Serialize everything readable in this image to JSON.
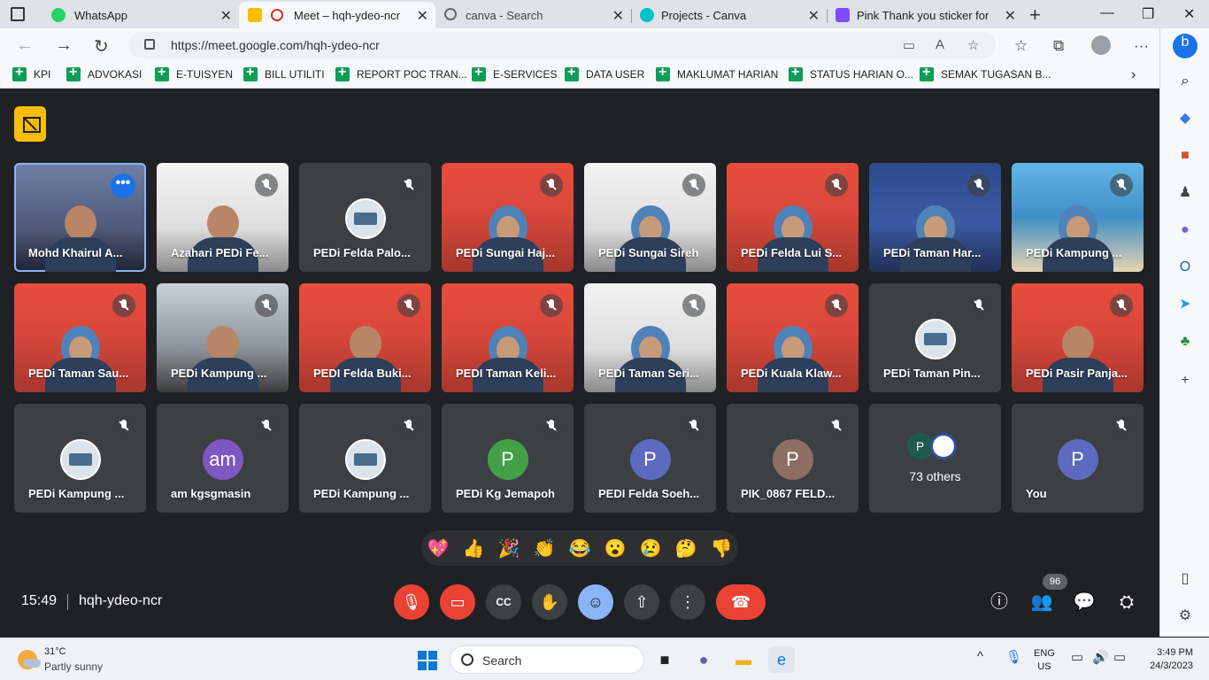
{
  "browser": {
    "tabs": [
      {
        "title": "WhatsApp",
        "active": false
      },
      {
        "title": "Meet – hqh-ydeo-ncr",
        "active": true
      },
      {
        "title": "canva - Search",
        "active": false
      },
      {
        "title": "Projects - Canva",
        "active": false
      },
      {
        "title": "Pink Thank you sticker for sm",
        "active": false
      }
    ],
    "url": "https://meet.google.com/hqh-ydeo-ncr",
    "bookmarks": [
      "KPI",
      "ADVOKASI",
      "E-TUISYEN",
      "BILL UTILITI",
      "REPORT POC TRAN...",
      "E-SERVICES",
      "DATA USER",
      "MAKLUMAT HARIAN",
      "STATUS HARIAN O...",
      "SEMAK TUGASAN B..."
    ]
  },
  "meet": {
    "participants": [
      {
        "name": "Mohd Khairul A...",
        "type": "video",
        "bg": "dusk",
        "menu": true
      },
      {
        "name": "Azahari PEDi Fe...",
        "type": "video",
        "bg": "white"
      },
      {
        "name": "PEDi Felda Palo...",
        "type": "avatar-img"
      },
      {
        "name": "PEDi Sungai Haj...",
        "type": "video",
        "bg": "red",
        "hijab": true
      },
      {
        "name": "PEDi Sungai Sireh",
        "type": "video",
        "bg": "white",
        "hijab": true
      },
      {
        "name": "PEDi Felda Lui S...",
        "type": "video",
        "bg": "red",
        "hijab": true
      },
      {
        "name": "PEDi Taman Har...",
        "type": "video",
        "bg": "blue",
        "hijab": true
      },
      {
        "name": "PEDi Kampung ...",
        "type": "video",
        "bg": "beach",
        "hijab": true
      },
      {
        "name": "PEDi Taman Sau...",
        "type": "video",
        "bg": "red",
        "hijab": true
      },
      {
        "name": "PEDi Kampung ...",
        "type": "video",
        "bg": "room"
      },
      {
        "name": "PEDI Felda Buki...",
        "type": "video",
        "bg": "red"
      },
      {
        "name": "PEDI Taman Keli...",
        "type": "video",
        "bg": "red",
        "hijab": true
      },
      {
        "name": "PEDi Taman Seri...",
        "type": "video",
        "bg": "white",
        "hijab": true
      },
      {
        "name": "PEDi Kuala Klaw...",
        "type": "video",
        "bg": "red",
        "hijab": true
      },
      {
        "name": "PEDi Taman Pin...",
        "type": "avatar-img"
      },
      {
        "name": "PEDi Pasir Panja...",
        "type": "video",
        "bg": "red"
      },
      {
        "name": "PEDi Kampung ...",
        "type": "avatar-img"
      },
      {
        "name": "am kgsgmasin",
        "type": "avatar",
        "letter": "am",
        "color": "#7e57c2"
      },
      {
        "name": "PEDi Kampung ...",
        "type": "avatar-img"
      },
      {
        "name": "PEDi Kg Jemapoh",
        "type": "avatar",
        "letter": "P",
        "color": "#43a047"
      },
      {
        "name": "PEDI Felda Soeh...",
        "type": "avatar",
        "letter": "P",
        "color": "#5c6bc0"
      },
      {
        "name": "PIK_0867 FELD...",
        "type": "avatar",
        "letter": "P",
        "color": "#8d6e63"
      },
      {
        "name": "",
        "type": "others",
        "label": "73 others",
        "letter": "P"
      },
      {
        "name": "You",
        "type": "avatar",
        "letter": "P",
        "color": "#5c6bc0"
      }
    ],
    "reactions": [
      "💖",
      "👍",
      "🎉",
      "👏",
      "😂",
      "😮",
      "😢",
      "🤔",
      "👎"
    ],
    "time": "15:49",
    "meeting_code": "hqh-ydeo-ncr",
    "participant_count": "96"
  },
  "taskbar": {
    "temperature": "31°C",
    "weather": "Partly sunny",
    "search_label": "Search",
    "lang_line1": "ENG",
    "lang_line2": "US",
    "time": "3:49 PM",
    "date": "24/3/2023"
  }
}
